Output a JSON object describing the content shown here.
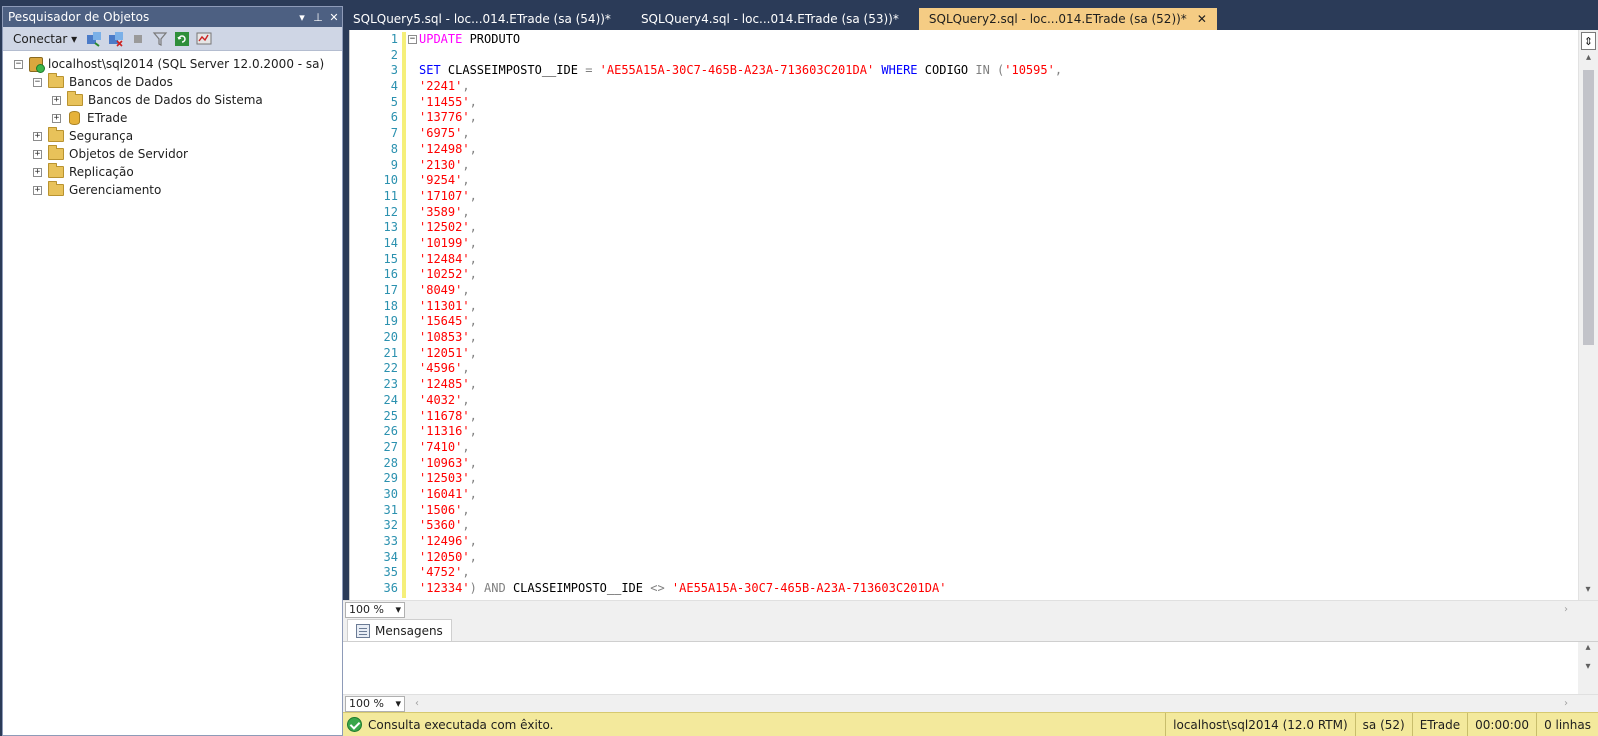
{
  "explorer": {
    "title": "Pesquisador de Objetos",
    "controls": [
      "▾",
      "ᵖ",
      "✕"
    ],
    "connect_label": "Conectar",
    "tree": {
      "server": "localhost\\sql2014 (SQL Server 12.0.2000 - sa)",
      "databases": "Bancos de Dados",
      "system_databases": "Bancos de Dados do Sistema",
      "etrade": "ETrade",
      "security": "Segurança",
      "server_objects": "Objetos de Servidor",
      "replication": "Replicação",
      "management": "Gerenciamento"
    }
  },
  "tabs": [
    {
      "label": "SQLQuery5.sql - loc...014.ETrade (sa (54))*"
    },
    {
      "label": "SQLQuery4.sql - loc...014.ETrade (sa (53))*"
    },
    {
      "label": "SQLQuery2.sql - loc...014.ETrade (sa (52))*",
      "close": "✕"
    }
  ],
  "editor": {
    "line_numbers": [
      "1",
      "2",
      "3",
      "4",
      "5",
      "6",
      "7",
      "8",
      "9",
      "10",
      "11",
      "12",
      "13",
      "14",
      "15",
      "16",
      "17",
      "18",
      "19",
      "20",
      "21",
      "22",
      "23",
      "24",
      "25",
      "26",
      "27",
      "28",
      "29",
      "30",
      "31",
      "32",
      "33",
      "34",
      "35",
      "36"
    ],
    "line1_kw": "UPDATE",
    "line1_table": " PRODUTO",
    "line3": {
      "kw_set": "SET",
      "col": " CLASSEIMPOSTO__IDE ",
      "eq": "=",
      "guid": " 'AE55A15A-30C7-465B-A23A-713603C201DA'",
      "kw_where": " WHERE",
      "col2": " CODIGO ",
      "kw_in": "IN",
      "paren": " (",
      "first": "'10595'",
      "comma": ","
    },
    "values": [
      "'2241'",
      "'11455'",
      "'13776'",
      "'6975'",
      "'12498'",
      "'2130'",
      "'9254'",
      "'17107'",
      "'3589'",
      "'12502'",
      "'10199'",
      "'12484'",
      "'10252'",
      "'8049'",
      "'11301'",
      "'15645'",
      "'10853'",
      "'12051'",
      "'4596'",
      "'12485'",
      "'4032'",
      "'11678'",
      "'11316'",
      "'7410'",
      "'10963'",
      "'12503'",
      "'16041'",
      "'1506'",
      "'5360'",
      "'12496'",
      "'12050'",
      "'4752'"
    ],
    "comma": ",",
    "line36": {
      "last": "'12334'",
      "close": ")",
      "kw_and": " AND",
      "col": " CLASSEIMPOSTO__IDE ",
      "neq": "<>",
      "guid": " 'AE55A15A-30C7-465B-A23A-713603C201DA'"
    }
  },
  "zoom": {
    "value": "100 %",
    "results_value": "100 %"
  },
  "results": {
    "tab_label": "Mensagens"
  },
  "status": {
    "message": "Consulta executada com êxito.",
    "server": "localhost\\sql2014 (12.0 RTM)",
    "session": "sa (52)",
    "database": "ETrade",
    "elapsed": "00:00:00",
    "rows": "0 linhas"
  }
}
